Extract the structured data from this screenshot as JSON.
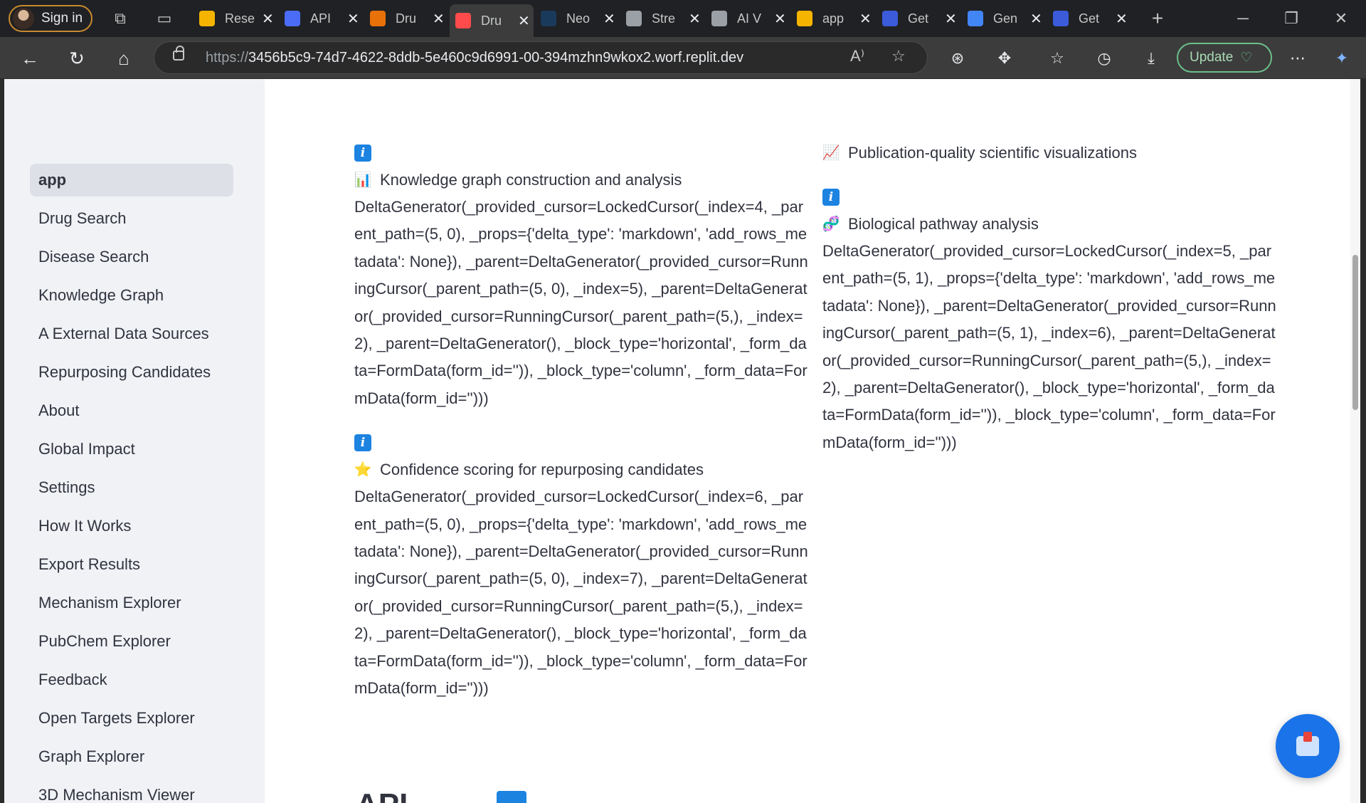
{
  "browser": {
    "signin_label": "Sign in",
    "tabs": [
      {
        "title": "Rese",
        "color": "#f4b400"
      },
      {
        "title": "API",
        "color": "#4a6cf7"
      },
      {
        "title": "Dru",
        "color": "#e8710a"
      },
      {
        "title": "Dru",
        "color": "#ff4b4b",
        "active": true
      },
      {
        "title": "Neo",
        "color": "#1a3a5c"
      },
      {
        "title": "Stre",
        "color": "#9aa0a6"
      },
      {
        "title": "AI V",
        "color": "#9aa0a6"
      },
      {
        "title": "app",
        "color": "#f4b400"
      },
      {
        "title": "Get",
        "color": "#3b5bdb"
      },
      {
        "title": "Gen",
        "color": "#4285f4"
      },
      {
        "title": "Get",
        "color": "#3b5bdb"
      }
    ],
    "url_prefix": "https://",
    "url_host": "3456b5c9-74d7-4622-8ddb-5e460c9d6991-00-394mzhn9wkox2.worf.replit.dev",
    "update_label": "Update"
  },
  "sidebar": {
    "items": [
      {
        "label": "app",
        "selected": true
      },
      {
        "label": "Drug Search"
      },
      {
        "label": "Disease Search"
      },
      {
        "label": "Knowledge Graph"
      },
      {
        "label": "A External Data Sources"
      },
      {
        "label": "Repurposing Candidates"
      },
      {
        "label": "About"
      },
      {
        "label": "Global Impact"
      },
      {
        "label": "Settings"
      },
      {
        "label": "How It Works"
      },
      {
        "label": "Export Results"
      },
      {
        "label": "Mechanism Explorer"
      },
      {
        "label": "PubChem Explorer"
      },
      {
        "label": "Feedback"
      },
      {
        "label": "Open Targets Explorer"
      },
      {
        "label": "Graph Explorer"
      },
      {
        "label": "3D Mechanism Viewer"
      }
    ]
  },
  "main": {
    "left_column": [
      {
        "badge": "i",
        "icon": "bar-chart-icon",
        "feature": "Knowledge graph construction and analysis",
        "repr": "DeltaGenerator(_provided_cursor=LockedCursor(_index=4, _parent_path=(5, 0), _props={'delta_type': 'markdown', 'add_rows_metadata': None}), _parent=DeltaGenerator(_provided_cursor=RunningCursor(_parent_path=(5, 0), _index=5), _parent=DeltaGenerator(_provided_cursor=RunningCursor(_parent_path=(5,), _index=2), _parent=DeltaGenerator(), _block_type='horizontal', _form_data=FormData(form_id='')), _block_type='column', _form_data=FormData(form_id='')))"
      },
      {
        "badge": "i",
        "icon": "star-icon",
        "feature": "Confidence scoring for repurposing candidates",
        "repr": "DeltaGenerator(_provided_cursor=LockedCursor(_index=6, _parent_path=(5, 0), _props={'delta_type': 'markdown', 'add_rows_metadata': None}), _parent=DeltaGenerator(_provided_cursor=RunningCursor(_parent_path=(5, 0), _index=7), _parent=DeltaGenerator(_provided_cursor=RunningCursor(_parent_path=(5,), _index=2), _parent=DeltaGenerator(), _block_type='horizontal', _form_data=FormData(form_id='')), _block_type='column', _form_data=FormData(form_id='')))"
      }
    ],
    "right_column": {
      "top_feature": "Publication-quality scientific visualizations",
      "top_icon": "line-chart-icon",
      "block": {
        "badge": "i",
        "icon": "dna-icon",
        "feature": "Biological pathway analysis",
        "repr": "DeltaGenerator(_provided_cursor=LockedCursor(_index=5, _parent_path=(5, 1), _props={'delta_type': 'markdown', 'add_rows_metadata': None}), _parent=DeltaGenerator(_provided_cursor=RunningCursor(_parent_path=(5, 1), _index=6), _parent=DeltaGenerator(_provided_cursor=RunningCursor(_parent_path=(5,), _index=2), _parent=DeltaGenerator(), _block_type='horizontal', _form_data=FormData(form_id='')), _block_type='column', _form_data=FormData(form_id='')))"
      }
    },
    "heading_peek": "API..."
  }
}
